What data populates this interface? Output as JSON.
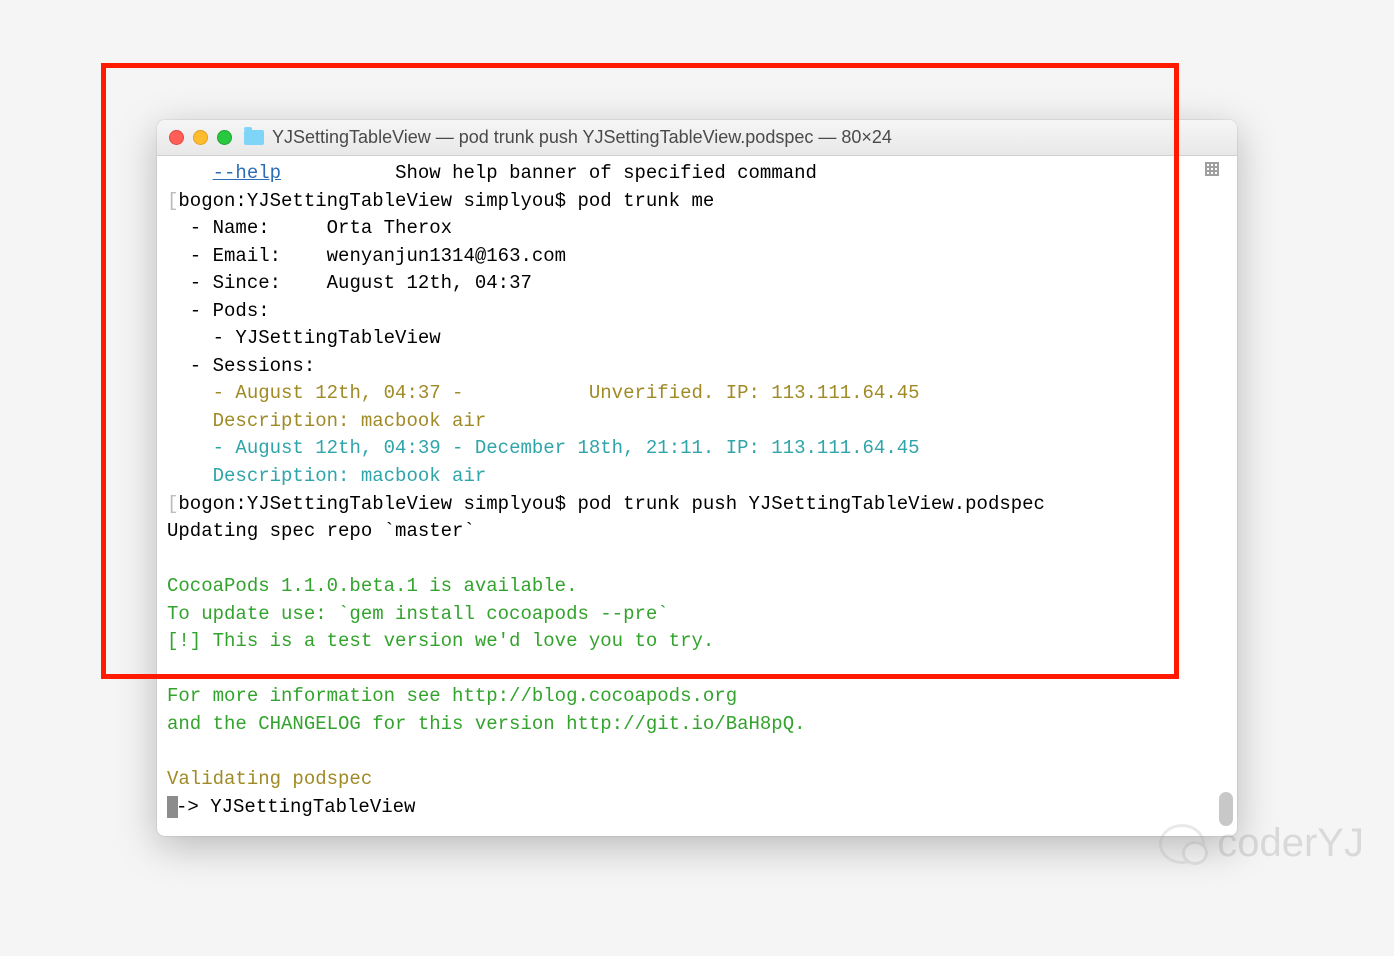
{
  "window": {
    "title": "YJSettingTableView — pod trunk push YJSettingTableView.podspec — 80×24"
  },
  "help": {
    "flag": "--help",
    "desc": "Show help banner of specified command"
  },
  "prompt1": {
    "bracket_open": "[",
    "text": "bogon:YJSettingTableView simplyou$ pod trunk me",
    "bracket_close": "]"
  },
  "info": {
    "name_label": "  - Name:     ",
    "name_value": "Orta Therox",
    "email_label": "  - Email:    ",
    "email_value": "wenyanjun1314@163.com",
    "since_label": "  - Since:    ",
    "since_value": "August 12th, 04:37",
    "pods_label": "  - Pods:",
    "pod_item": "    - YJSettingTableView",
    "sessions_label": "  - Sessions:"
  },
  "session1": {
    "line1_a": "    - ",
    "line1_b": "August 12th, 04:37 -           Unverified. IP: 113.111.64.45",
    "line2": "    Description: macbook air"
  },
  "session2": {
    "line1_a": "    - ",
    "line1_b": "August 12th, 04:39 - December 18th, 21:11. IP: 113.111.64.45",
    "line2": "    Description: macbook air"
  },
  "prompt2": {
    "bracket_open": "[",
    "text": "bogon:YJSettingTableView simplyou$ pod trunk push YJSettingTableView.podspec",
    "bracket_close": "]"
  },
  "updating": "Updating spec repo `master`",
  "notice": {
    "l1": "CocoaPods 1.1.0.beta.1 is available.",
    "l2": "To update use: `gem install cocoapods --pre`",
    "l3": "[!] This is a test version we'd love you to try.",
    "l4": "For more information see http://blog.cocoapods.org",
    "l5": "and the CHANGELOG for this version http://git.io/BaH8pQ."
  },
  "validating": "Validating podspec",
  "arrow_line": "-> YJSettingTableView",
  "watermark": "coderYJ"
}
